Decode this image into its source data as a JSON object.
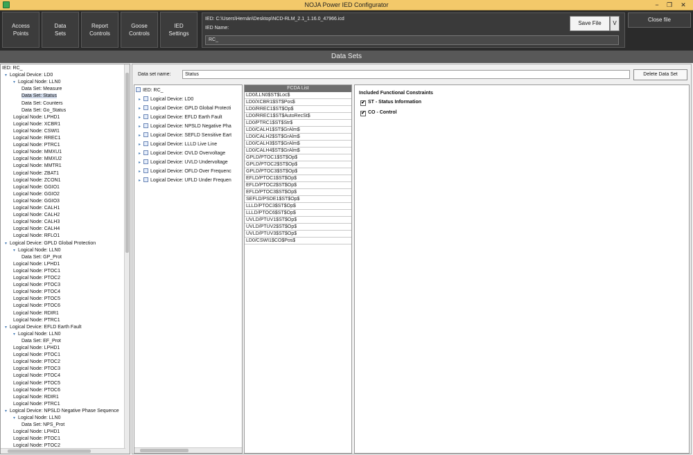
{
  "window": {
    "title": "NOJA Power IED Configurator",
    "min": "−",
    "max": "❐",
    "close": "✕"
  },
  "toolbar": {
    "buttons": [
      "Access\nPoints",
      "Data\nSets",
      "Report\nControls",
      "Goose\nControls",
      "IED\nSettings"
    ],
    "ied_path": "IED: C:\\Users\\Hernán\\Desktop\\NCD-RLM_2.1_1.16.0_47966.icd",
    "ied_name_label": "IED Name:",
    "ied_name_value": "RC_",
    "save_label": "Save File",
    "save_drop": "V",
    "close_label": "Close file"
  },
  "section_title": "Data Sets",
  "tree": {
    "ied_label": "IED: RC_",
    "nodes": [
      {
        "level": 0,
        "text": "IED: RC_"
      },
      {
        "level": 1,
        "tog": "▾",
        "text": "Logical Device: LD0"
      },
      {
        "level": 2,
        "tog": "▾",
        "text": "Logical Node: LLN0"
      },
      {
        "level": 3,
        "text": "Data Set: Measure"
      },
      {
        "level": 3,
        "text": "Data Set: Status",
        "selected": true
      },
      {
        "level": 3,
        "text": "Data Set: Counters"
      },
      {
        "level": 3,
        "text": "Data Set: Go_Status"
      },
      {
        "level": 2,
        "text": "Logical Node: LPHD1"
      },
      {
        "level": 2,
        "text": "Logical Node: XCBR1"
      },
      {
        "level": 2,
        "text": "Logical Node: CSWI1"
      },
      {
        "level": 2,
        "text": "Logical Node: RREC1"
      },
      {
        "level": 2,
        "text": "Logical Node: PTRC1"
      },
      {
        "level": 2,
        "text": "Logical Node: MMXU1"
      },
      {
        "level": 2,
        "text": "Logical Node: MMXU2"
      },
      {
        "level": 2,
        "text": "Logical Node: MMTR1"
      },
      {
        "level": 2,
        "text": "Logical Node: ZBAT1"
      },
      {
        "level": 2,
        "text": "Logical Node: ZCON1"
      },
      {
        "level": 2,
        "text": "Logical Node: GGIO1"
      },
      {
        "level": 2,
        "text": "Logical Node: GGIO2"
      },
      {
        "level": 2,
        "text": "Logical Node: GGIO3"
      },
      {
        "level": 2,
        "text": "Logical Node: CALH1"
      },
      {
        "level": 2,
        "text": "Logical Node: CALH2"
      },
      {
        "level": 2,
        "text": "Logical Node: CALH3"
      },
      {
        "level": 2,
        "text": "Logical Node: CALH4"
      },
      {
        "level": 2,
        "text": "Logical Node: RFLO1"
      },
      {
        "level": 1,
        "tog": "▾",
        "text": "Logical Device: GPLD Global Protection"
      },
      {
        "level": 2,
        "tog": "▾",
        "text": "Logical Node: LLN0"
      },
      {
        "level": 3,
        "text": "Data Set: GP_Prot"
      },
      {
        "level": 2,
        "text": "Logical Node: LPHD1"
      },
      {
        "level": 2,
        "text": "Logical Node: PTOC1"
      },
      {
        "level": 2,
        "text": "Logical Node: PTOC2"
      },
      {
        "level": 2,
        "text": "Logical Node: PTOC3"
      },
      {
        "level": 2,
        "text": "Logical Node: PTOC4"
      },
      {
        "level": 2,
        "text": "Logical Node: PTOC5"
      },
      {
        "level": 2,
        "text": "Logical Node: PTOC6"
      },
      {
        "level": 2,
        "text": "Logical Node: RDIR1"
      },
      {
        "level": 2,
        "text": "Logical Node: PTRC1"
      },
      {
        "level": 1,
        "tog": "▾",
        "text": "Logical Device: EFLD Earth Fault"
      },
      {
        "level": 2,
        "tog": "▾",
        "text": "Logical Node: LLN0"
      },
      {
        "level": 3,
        "text": "Data Set: EF_Prot"
      },
      {
        "level": 2,
        "text": "Logical Node: LPHD1"
      },
      {
        "level": 2,
        "text": "Logical Node: PTOC1"
      },
      {
        "level": 2,
        "text": "Logical Node: PTOC2"
      },
      {
        "level": 2,
        "text": "Logical Node: PTOC3"
      },
      {
        "level": 2,
        "text": "Logical Node: PTOC4"
      },
      {
        "level": 2,
        "text": "Logical Node: PTOC5"
      },
      {
        "level": 2,
        "text": "Logical Node: PTOC6"
      },
      {
        "level": 2,
        "text": "Logical Node: RDIR1"
      },
      {
        "level": 2,
        "text": "Logical Node: PTRC1"
      },
      {
        "level": 1,
        "tog": "▾",
        "text": "Logical Device: NPSLD Negative Phase Sequence"
      },
      {
        "level": 2,
        "tog": "▾",
        "text": "Logical Node: LLN0"
      },
      {
        "level": 3,
        "text": "Data Set: NPS_Prot"
      },
      {
        "level": 2,
        "text": "Logical Node: LPHD1"
      },
      {
        "level": 2,
        "text": "Logical Node: PTOC1"
      },
      {
        "level": 2,
        "text": "Logical Node: PTOC2"
      }
    ]
  },
  "dataset": {
    "name_label": "Data set name:",
    "name_value": "Status",
    "delete_label": "Delete Data Set"
  },
  "devices": [
    {
      "tog": "",
      "text": "IED: RC_"
    },
    {
      "tog": "▸",
      "text": "Logical Device: LD0"
    },
    {
      "tog": "▸",
      "text": "Logical Device: GPLD Global Protecti"
    },
    {
      "tog": "▸",
      "text": "Logical Device: EFLD Earth Fault"
    },
    {
      "tog": "▸",
      "text": "Logical Device: NPSLD Negative Pha"
    },
    {
      "tog": "▸",
      "text": "Logical Device: SEFLD Sensitive Eart"
    },
    {
      "tog": "▸",
      "text": "Logical Device: LLLD Live Line"
    },
    {
      "tog": "▸",
      "text": "Logical Device: OVLD Overvoltage"
    },
    {
      "tog": "▸",
      "text": "Logical Device: UVLD Undervoltage"
    },
    {
      "tog": "▸",
      "text": "Logical Device: OFLD Over Frequenc"
    },
    {
      "tog": "▸",
      "text": "Logical Device: UFLD Under Frequen"
    }
  ],
  "fcda": {
    "header": "FCDA List",
    "items": [
      "LD0/LLN0$ST$Loc$",
      "LD0/XCBR1$ST$Pos$",
      "LD0/RREC1$ST$Op$",
      "LD0/RREC1$ST$AutoRecSt$",
      "LD0/PTRC1$ST$Str$",
      "LD0/CALH1$ST$GrAlm$",
      "LD0/CALH2$ST$GrAlm$",
      "LD0/CALH3$ST$GrAlm$",
      "LD0/CALH4$ST$GrAlm$",
      "GPLD/PTOC1$ST$Op$",
      "GPLD/PTOC2$ST$Op$",
      "GPLD/PTOC3$ST$Op$",
      "EFLD/PTOC1$ST$Op$",
      "EFLD/PTOC2$ST$Op$",
      "EFLD/PTOC3$ST$Op$",
      "SEFLD/PSDE1$ST$Op$",
      "LLLD/PTOC3$ST$Op$",
      "LLLD/PTOC6$ST$Op$",
      "UVLD/PTUV1$ST$Op$",
      "UVLD/PTUV2$ST$Op$",
      "UVLD/PTUV3$ST$Op$",
      "LD0/CSWI1$CO$Pos$"
    ]
  },
  "fc": {
    "header": "Included Functional Constraints",
    "items": [
      {
        "label": "ST - Status Information",
        "checked": true
      },
      {
        "label": "CO - Control",
        "checked": true
      }
    ],
    "check_glyph": "✔"
  }
}
